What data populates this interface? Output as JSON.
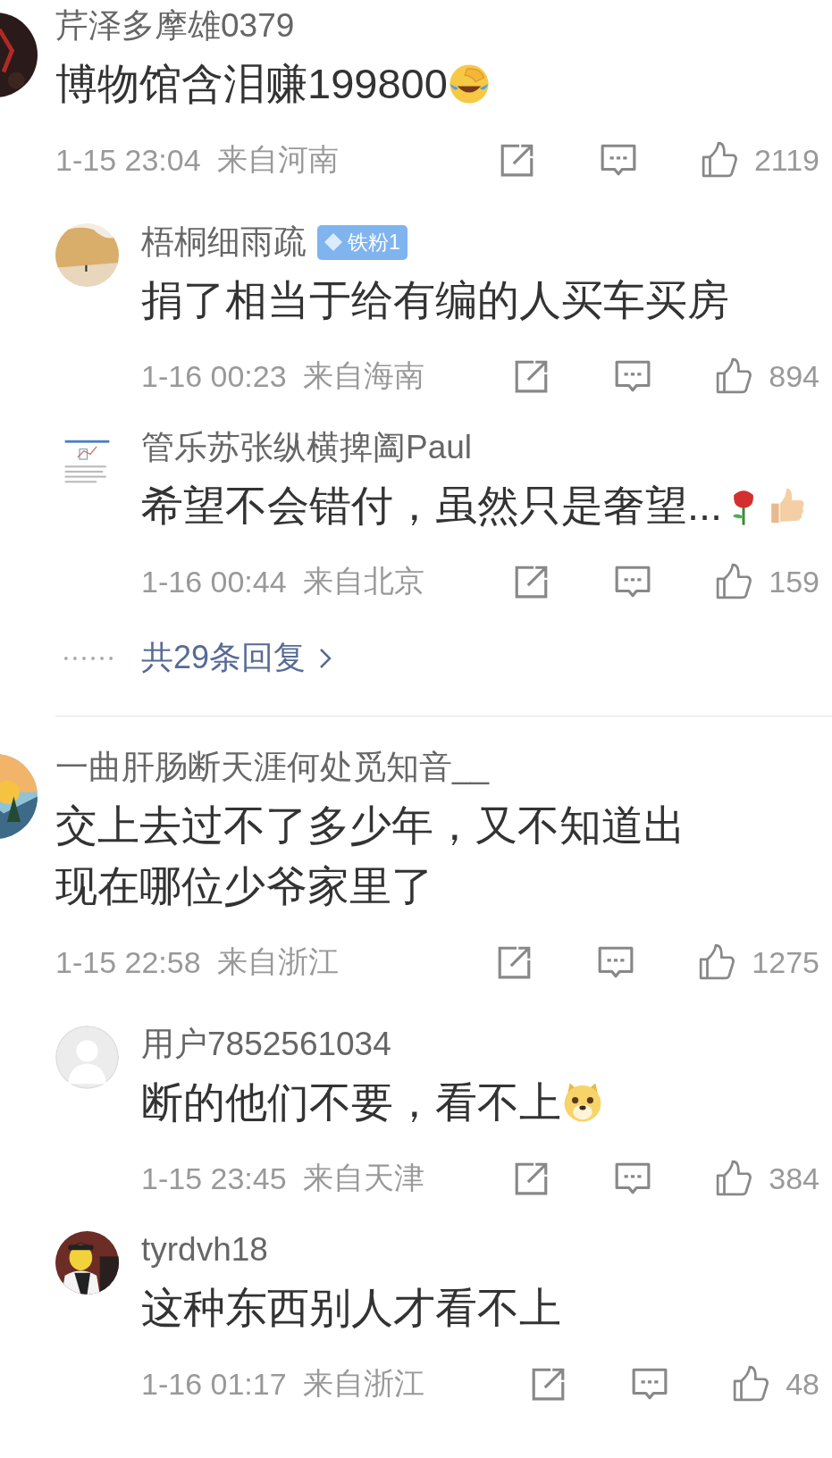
{
  "comments": [
    {
      "avatar": {
        "kind": "picture"
      },
      "name": "芹泽多摩雄0379",
      "text": "博物馆含泪赚199800",
      "emojis": [
        {
          "kind": "laugh-cry"
        }
      ],
      "time": "1-15 23:04",
      "location": "来自河南",
      "likes": "2119",
      "replies": [
        {
          "avatar": {
            "kind": "picture"
          },
          "name": "梧桐细雨疏",
          "badge": "铁粉1",
          "text": "捐了相当于给有编的人买车买房",
          "time": "1-16 00:23",
          "location": "来自海南",
          "likes": "894"
        },
        {
          "avatar": {
            "kind": "picture"
          },
          "name": "管乐苏张纵横捭阖Paul",
          "text": "希望不会错付，虽然只是奢望...",
          "emojis": [
            {
              "kind": "rose"
            },
            {
              "kind": "thumbs-up"
            }
          ],
          "time": "1-16 00:44",
          "location": "来自北京",
          "likes": "159"
        }
      ],
      "more_replies": "共29条回复"
    },
    {
      "avatar": {
        "kind": "picture"
      },
      "name": "一曲肝肠断天涯何处觅知音__",
      "text": "交上去过不了多少年，又不知道出现在哪位少爷家里了",
      "time": "1-15 22:58",
      "location": "来自浙江",
      "likes": "1275",
      "replies": [
        {
          "avatar": {
            "kind": "silhouette"
          },
          "name": "用户7852561034",
          "text": "断的他们不要，看不上",
          "emojis": [
            {
              "kind": "doge"
            }
          ],
          "time": "1-15 23:45",
          "location": "来自天津",
          "likes": "384"
        },
        {
          "avatar": {
            "kind": "picture"
          },
          "name": "tyrdvh18",
          "text": "这种东西别人才看不上",
          "time": "1-16 01:17",
          "location": "来自浙江",
          "likes": "48"
        }
      ]
    }
  ]
}
